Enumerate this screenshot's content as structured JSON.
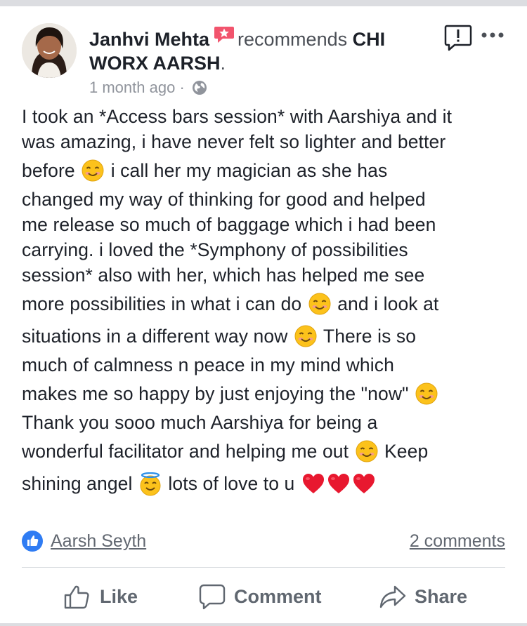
{
  "post": {
    "author": "Janhvi Mehta",
    "verb": "recommends",
    "page_name_part1": "CHI",
    "page_name_part2": "WORX AARSH",
    "page_name_punct": ".",
    "timestamp": "1 month ago",
    "separator": "·",
    "audience_icon": "globe-icon",
    "badge_icon": "star-recommendation-icon",
    "report_icon": "report-exclamation-icon",
    "more_icon": "more-dots-icon",
    "body_lines": [
      "I took an *Access bars session* with Aarshiya and it",
      "was amazing, i have never felt so lighter and better",
      "before",
      "i call her my magician as she has",
      "changed my way of thinking for good and helped",
      "me release so much of baggage which i had been",
      "carrying. i loved the *Symphony of possibilities",
      "session* also with her, which has helped me see",
      "more possibilities in what i can do",
      "and i look at",
      "situations in a different way now",
      "There is so",
      "much of calmness n peace in my mind which",
      "makes me so happy by just enjoying the \"now\"",
      "Thank you sooo much Aarshiya for being a",
      "wonderful facilitator and helping me out",
      "Keep",
      "shining angel",
      "lots of love to u"
    ]
  },
  "reactions": {
    "reactor": "Aarsh Seyth",
    "comments": "2 comments",
    "like_badge_icon": "thumbs-up-icon"
  },
  "actions": {
    "like": "Like",
    "comment": "Comment",
    "share": "Share"
  },
  "colors": {
    "accent": "#2f7cf3",
    "badge": "#f2546d",
    "heart": "#e8182f",
    "emoji_face": "#fcc21b"
  }
}
